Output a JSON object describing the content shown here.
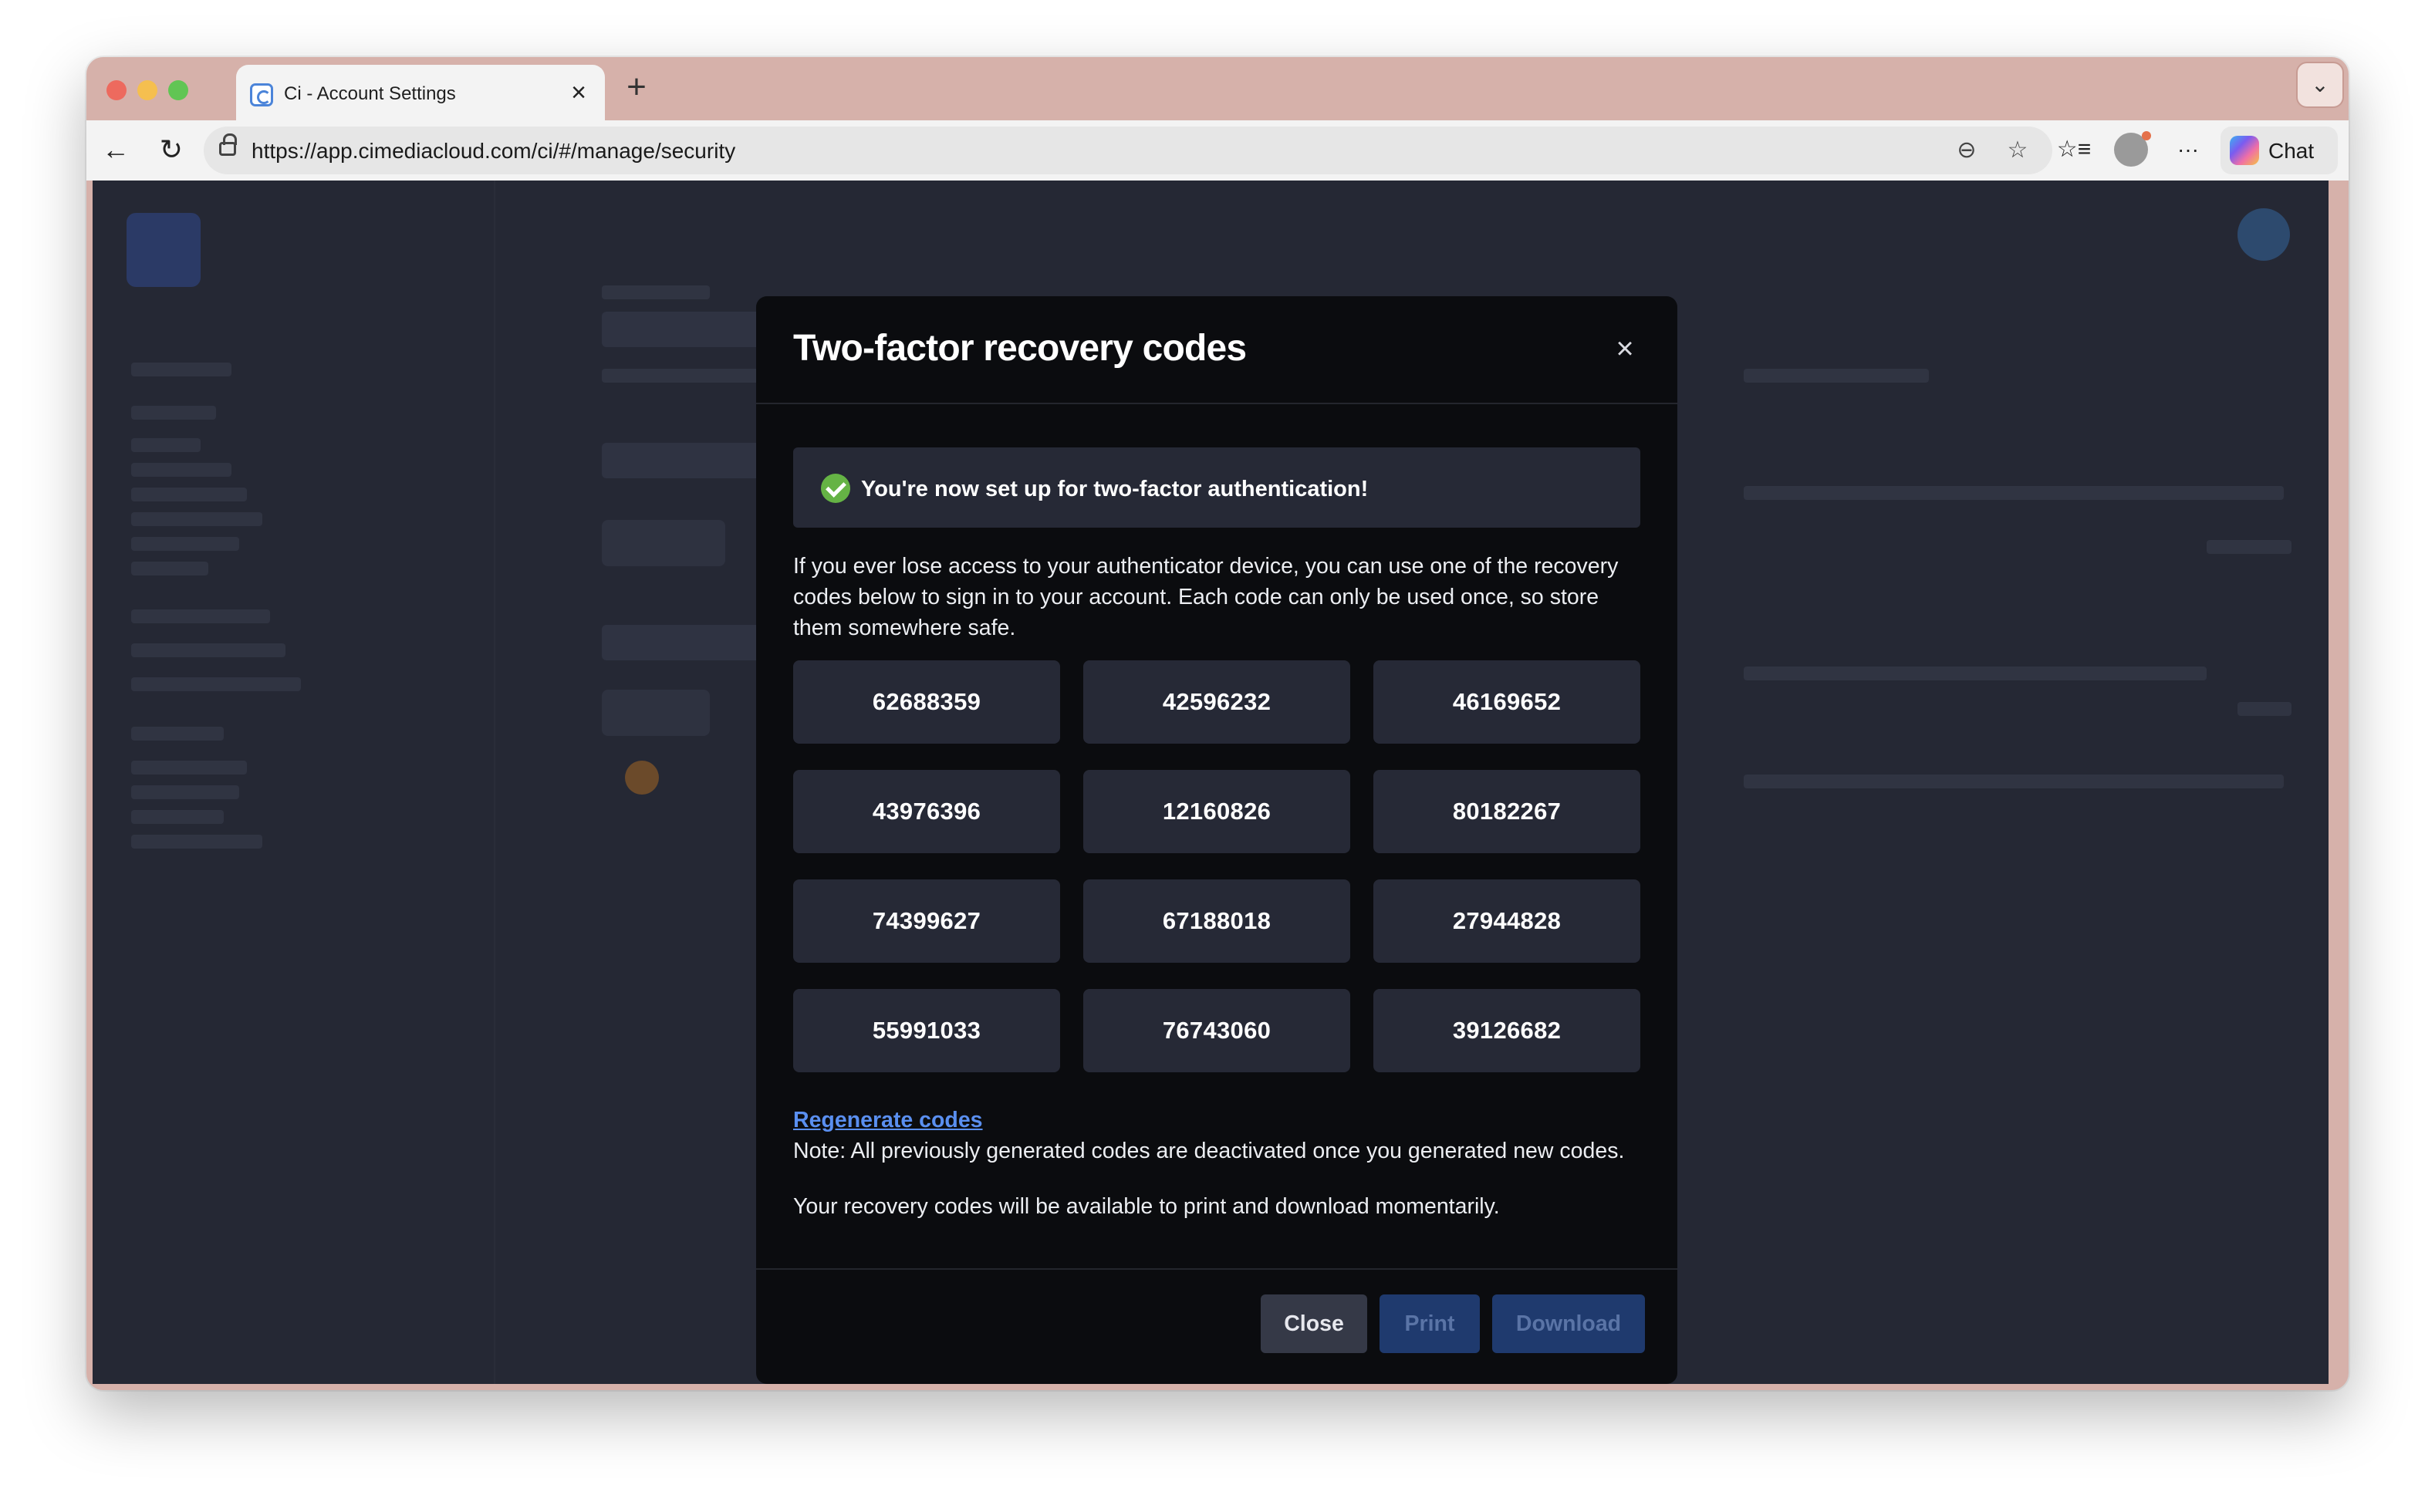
{
  "browser": {
    "tab": {
      "title": "Ci - Account Settings",
      "close_glyph": "×"
    },
    "new_tab_glyph": "+",
    "tab_menu_glyph": "⌄",
    "address": "https://app.cimediacloud.com/ci/#/manage/security",
    "chat_label": "Chat",
    "icons": {
      "back": "←",
      "reload": "↻",
      "reader": "⊖",
      "favorite": "☆",
      "favorites_list": "☆≡",
      "more": "···"
    }
  },
  "modal": {
    "title": "Two-factor recovery codes",
    "close_glyph": "×",
    "success_message": "You're now set up for two-factor authentication!",
    "intro": "If you ever lose access to your authenticator device, you can use one of the recovery codes below to sign in to your account. Each code can only be used once, so store them somewhere safe.",
    "codes": [
      "62688359",
      "42596232",
      "46169652",
      "43976396",
      "12160826",
      "80182267",
      "74399627",
      "67188018",
      "27944828",
      "55991033",
      "76743060",
      "39126682"
    ],
    "regenerate_label": "Regenerate codes",
    "note": "Note: All previously generated codes are deactivated once you generated new codes.",
    "availability_message": "Your recovery codes will be available to print and download momentarily.",
    "buttons": {
      "close": "Close",
      "print": "Print",
      "download": "Download"
    }
  },
  "colors": {
    "modal_bg": "#0b0c0f",
    "tile_bg": "#262936",
    "success_green": "#65b345",
    "link_blue": "#5a8ff0",
    "primary_disabled": "#1f3a6e",
    "overlay_bg": "#252834",
    "titlebar": "#d6b1aa"
  }
}
